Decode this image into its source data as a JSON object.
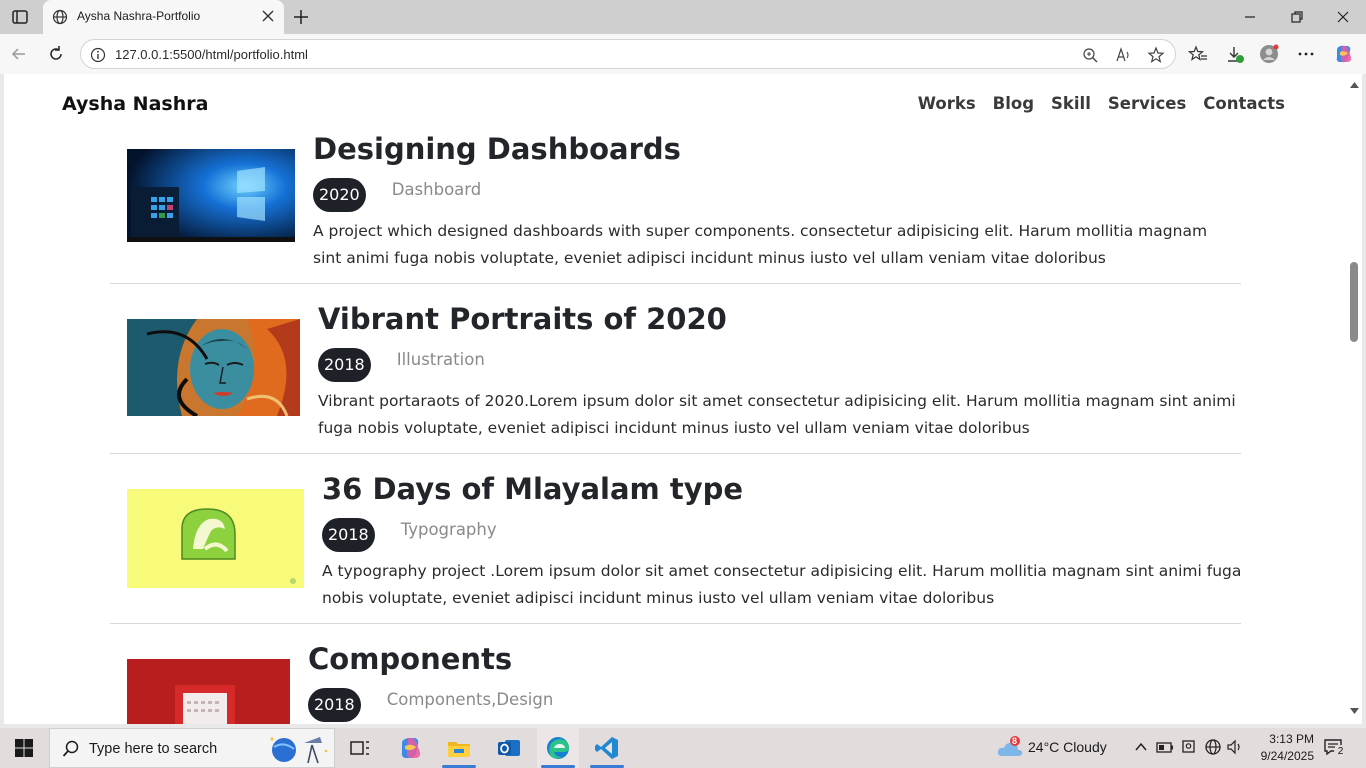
{
  "browser": {
    "tab_title": "Aysha Nashra-Portfolio",
    "url": "127.0.0.1:5500/html/portfolio.html"
  },
  "site": {
    "brand": "Aysha Nashra",
    "nav": [
      "Works",
      "Blog",
      "Skill",
      "Services",
      "Contacts"
    ]
  },
  "works": [
    {
      "title": "Designing Dashboards",
      "year": "2020",
      "category": "Dashboard",
      "description": "A project which designed dashboards with super components. consectetur adipisicing elit. Harum mollitia magnam sint animi fuga nobis voluptate, eveniet adipisci incidunt minus iusto vel ullam veniam vitae doloribus",
      "image": "windows-desktop-image"
    },
    {
      "title": "Vibrant Portraits of 2020",
      "year": "2018",
      "category": "Illustration",
      "description": "Vibrant portaraots of 2020.Lorem ipsum dolor sit amet consectetur adipisicing elit. Harum mollitia magnam sint animi fuga nobis voluptate, eveniet adipisci incidunt minus iusto vel ullam veniam vitae doloribus",
      "image": "portrait-illustration-image"
    },
    {
      "title": "36 Days of Mlayalam type",
      "year": "2018",
      "category": "Typography",
      "description": "A typography project .Lorem ipsum dolor sit amet consectetur adipisicing elit. Harum mollitia magnam sint animi fuga nobis voluptate, eveniet adipisci incidunt minus iusto vel ullam veniam vitae doloribus",
      "image": "malayalam-letter-image"
    },
    {
      "title": "Components",
      "year": "2018",
      "category": "Components,Design",
      "description": "",
      "image": "components-calendar-image"
    }
  ],
  "taskbar": {
    "search_placeholder": "Type here to search",
    "weather": "24°C  Cloudy",
    "weather_badge": "8",
    "time": "3:13 PM",
    "date": "9/24/2025",
    "notification_count": "2"
  }
}
